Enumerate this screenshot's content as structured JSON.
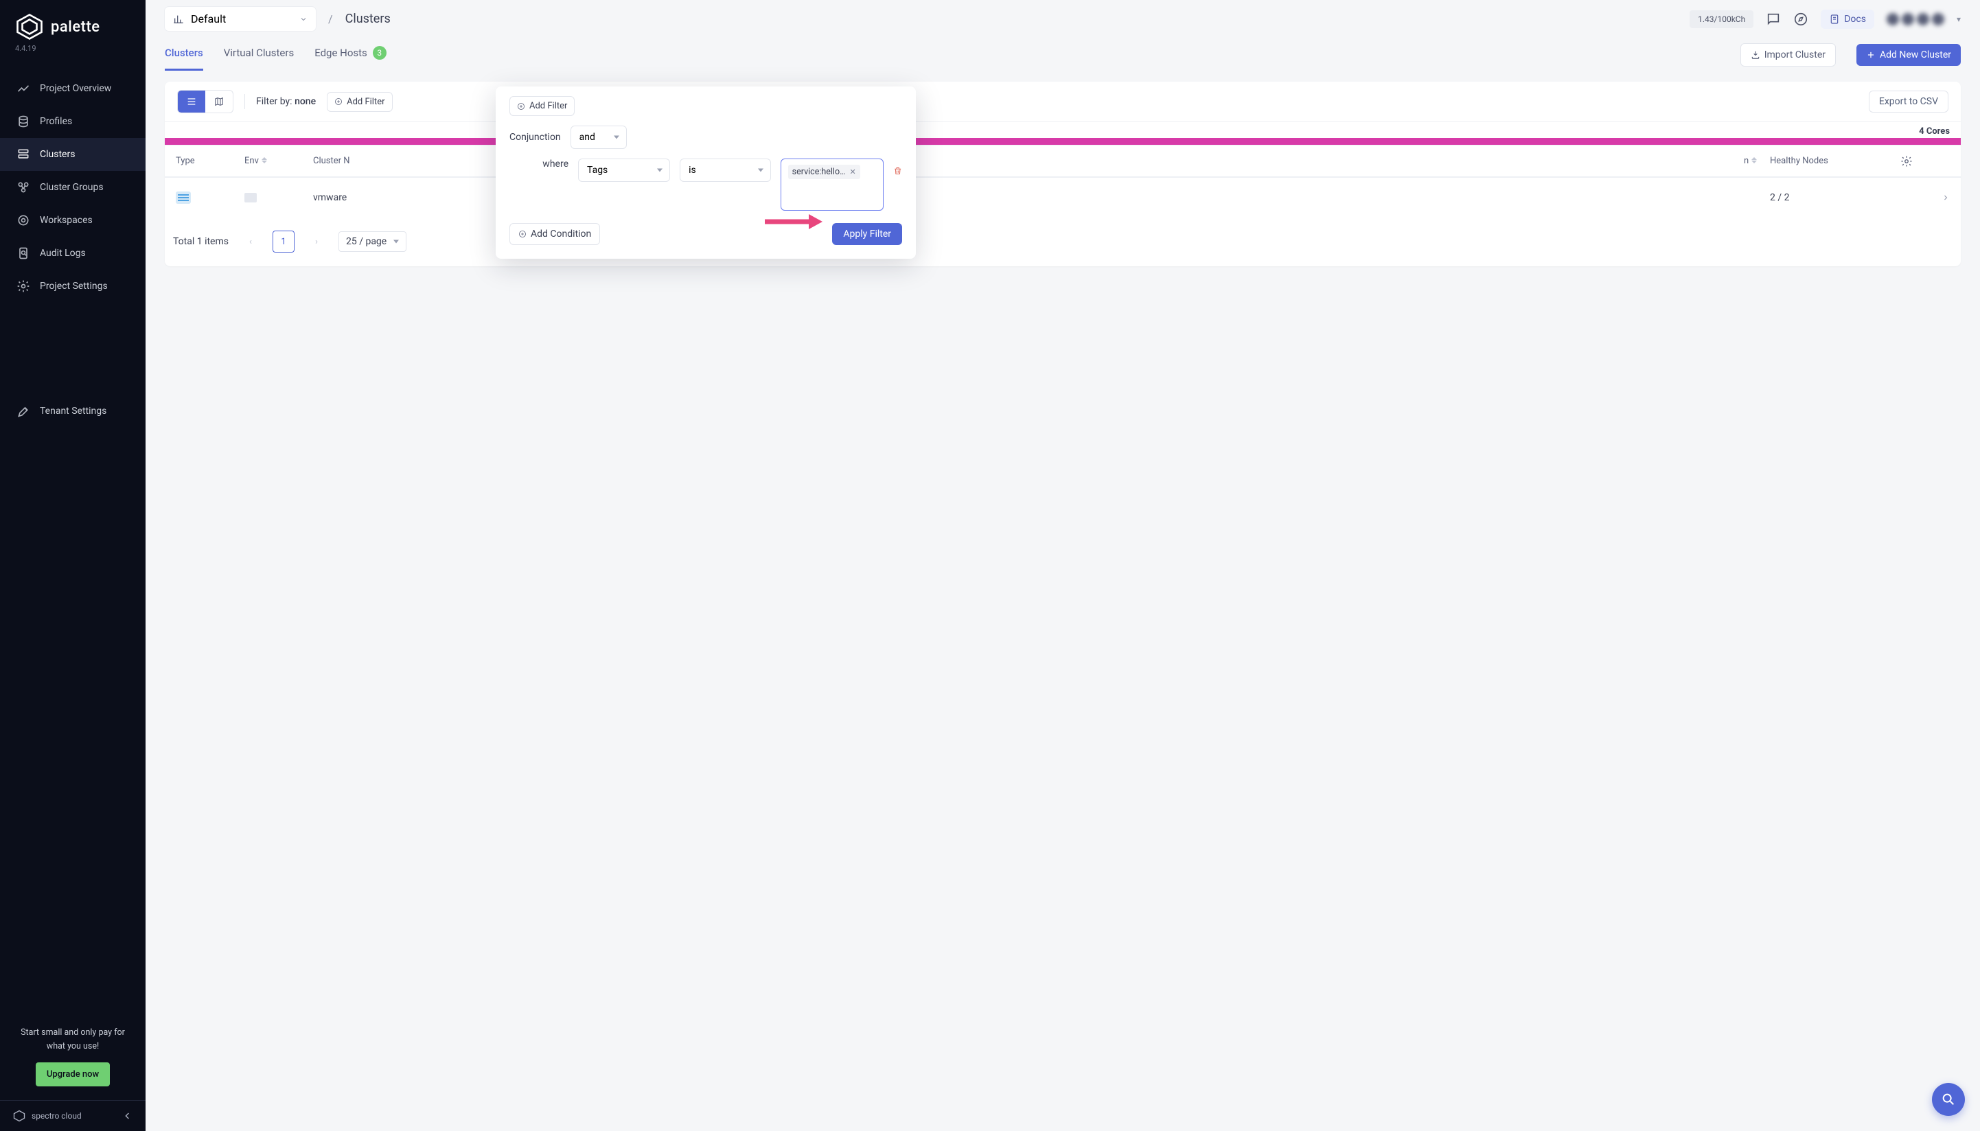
{
  "brand": {
    "name": "palette",
    "version": "4.4.19",
    "footer": "spectro cloud"
  },
  "sidebar": {
    "items": [
      {
        "label": "Project Overview"
      },
      {
        "label": "Profiles"
      },
      {
        "label": "Clusters"
      },
      {
        "label": "Cluster Groups"
      },
      {
        "label": "Workspaces"
      },
      {
        "label": "Audit Logs"
      },
      {
        "label": "Project Settings"
      }
    ],
    "tenant_settings": "Tenant Settings",
    "upgrade_text": "Start small and only pay for what you use!",
    "upgrade_btn": "Upgrade now"
  },
  "topbar": {
    "project_label": "Default",
    "breadcrumb_title": "Clusters",
    "credits": "1.43/100kCh",
    "docs": "Docs"
  },
  "tabs": {
    "clusters": "Clusters",
    "virtual": "Virtual Clusters",
    "edge": "Edge Hosts",
    "edge_count": "3",
    "import_btn": "Import Cluster",
    "add_btn": "Add New Cluster"
  },
  "toolbar": {
    "filter_by": "Filter by:",
    "filter_value": "none",
    "add_filter": "Add Filter",
    "export": "Export to CSV"
  },
  "usage": {
    "cores_label": "4 Cores"
  },
  "columns": {
    "type": "Type",
    "env": "Env",
    "name": "Cluster N",
    "health_hidden": "n",
    "healthy": "Healthy Nodes"
  },
  "row": {
    "name": "vmware",
    "healthy": "2 / 2"
  },
  "pager": {
    "total": "Total 1 items",
    "page": "1",
    "size": "25 / page"
  },
  "filter": {
    "add_filter": "Add Filter",
    "conjunction_label": "Conjunction",
    "conjunction_value": "and",
    "where_label": "where",
    "field_value": "Tags",
    "op_value": "is",
    "tag_value": "service:hello…",
    "add_condition": "Add Condition",
    "apply": "Apply Filter"
  }
}
